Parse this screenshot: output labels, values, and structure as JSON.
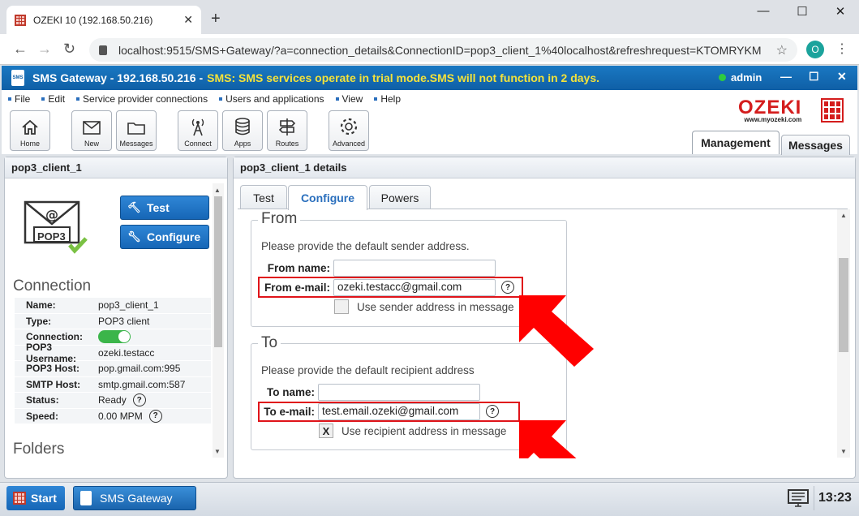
{
  "browser": {
    "tab_title": "OZEKI 10 (192.168.50.216)",
    "tab_close": "✕",
    "new_tab": "+",
    "window_minimize": "—",
    "window_maximize": "☐",
    "window_close": "✕",
    "url": "localhost:9515/SMS+Gateway/?a=connection_details&ConnectionID=pop3_client_1%40localhost&refreshrequest=KTOMRYKM",
    "profile_initial": "O"
  },
  "app": {
    "title": "SMS Gateway - 192.168.50.216 - ",
    "warning": "SMS: SMS services operate in trial mode.SMS will not function in 2 days.",
    "user": "admin",
    "menu": [
      "File",
      "Edit",
      "Service provider connections",
      "Users and applications",
      "View",
      "Help"
    ],
    "toolbar": [
      "Home",
      "New",
      "Messages",
      "Connect",
      "Apps",
      "Routes",
      "Advanced"
    ],
    "logo_text": "OZEKI",
    "logo_url": "www.myozeki.com",
    "main_tabs": [
      "Management",
      "Messages"
    ]
  },
  "left": {
    "title": "pop3_client_1",
    "envelope_label": "POP3",
    "test_btn": "Test",
    "configure_btn": "Configure",
    "connection_title": "Connection",
    "folders_title": "Folders",
    "rows": [
      {
        "k": "Name:",
        "v": "pop3_client_1"
      },
      {
        "k": "Type:",
        "v": "POP3 client"
      },
      {
        "k": "Connection:",
        "v": ""
      },
      {
        "k": "POP3 Username:",
        "v": "ozeki.testacc"
      },
      {
        "k": "POP3 Host:",
        "v": "pop.gmail.com:995"
      },
      {
        "k": "SMTP Host:",
        "v": "smtp.gmail.com:587"
      },
      {
        "k": "Status:",
        "v": "Ready"
      },
      {
        "k": "Speed:",
        "v": "0.00 MPM"
      }
    ],
    "connection_on": true
  },
  "right": {
    "title": "pop3_client_1 details",
    "tabs": [
      "Test",
      "Configure",
      "Powers"
    ],
    "from": {
      "legend": "From",
      "hint": "Please provide the default sender address.",
      "name_label": "From name:",
      "name_value": "",
      "email_label": "From e-mail:",
      "email_value": "ozeki.testacc@gmail.com",
      "check_label": "Use sender address in message",
      "checked": false
    },
    "to": {
      "legend": "To",
      "hint": "Please provide the default recipient address",
      "name_label": "To name:",
      "name_value": "",
      "email_label": "To e-mail:",
      "email_value": "test.email.ozeki@gmail.com",
      "check_label": "Use recipient address in message",
      "checked": true,
      "check_mark": "X"
    },
    "help": "?"
  },
  "taskbar": {
    "start": "Start",
    "app": "SMS Gateway",
    "clock": "13:23"
  },
  "colors": {
    "accent": "#1666b6",
    "warning": "#f3e23b",
    "highlight": "#e0141a",
    "arrow": "#ff0000"
  }
}
